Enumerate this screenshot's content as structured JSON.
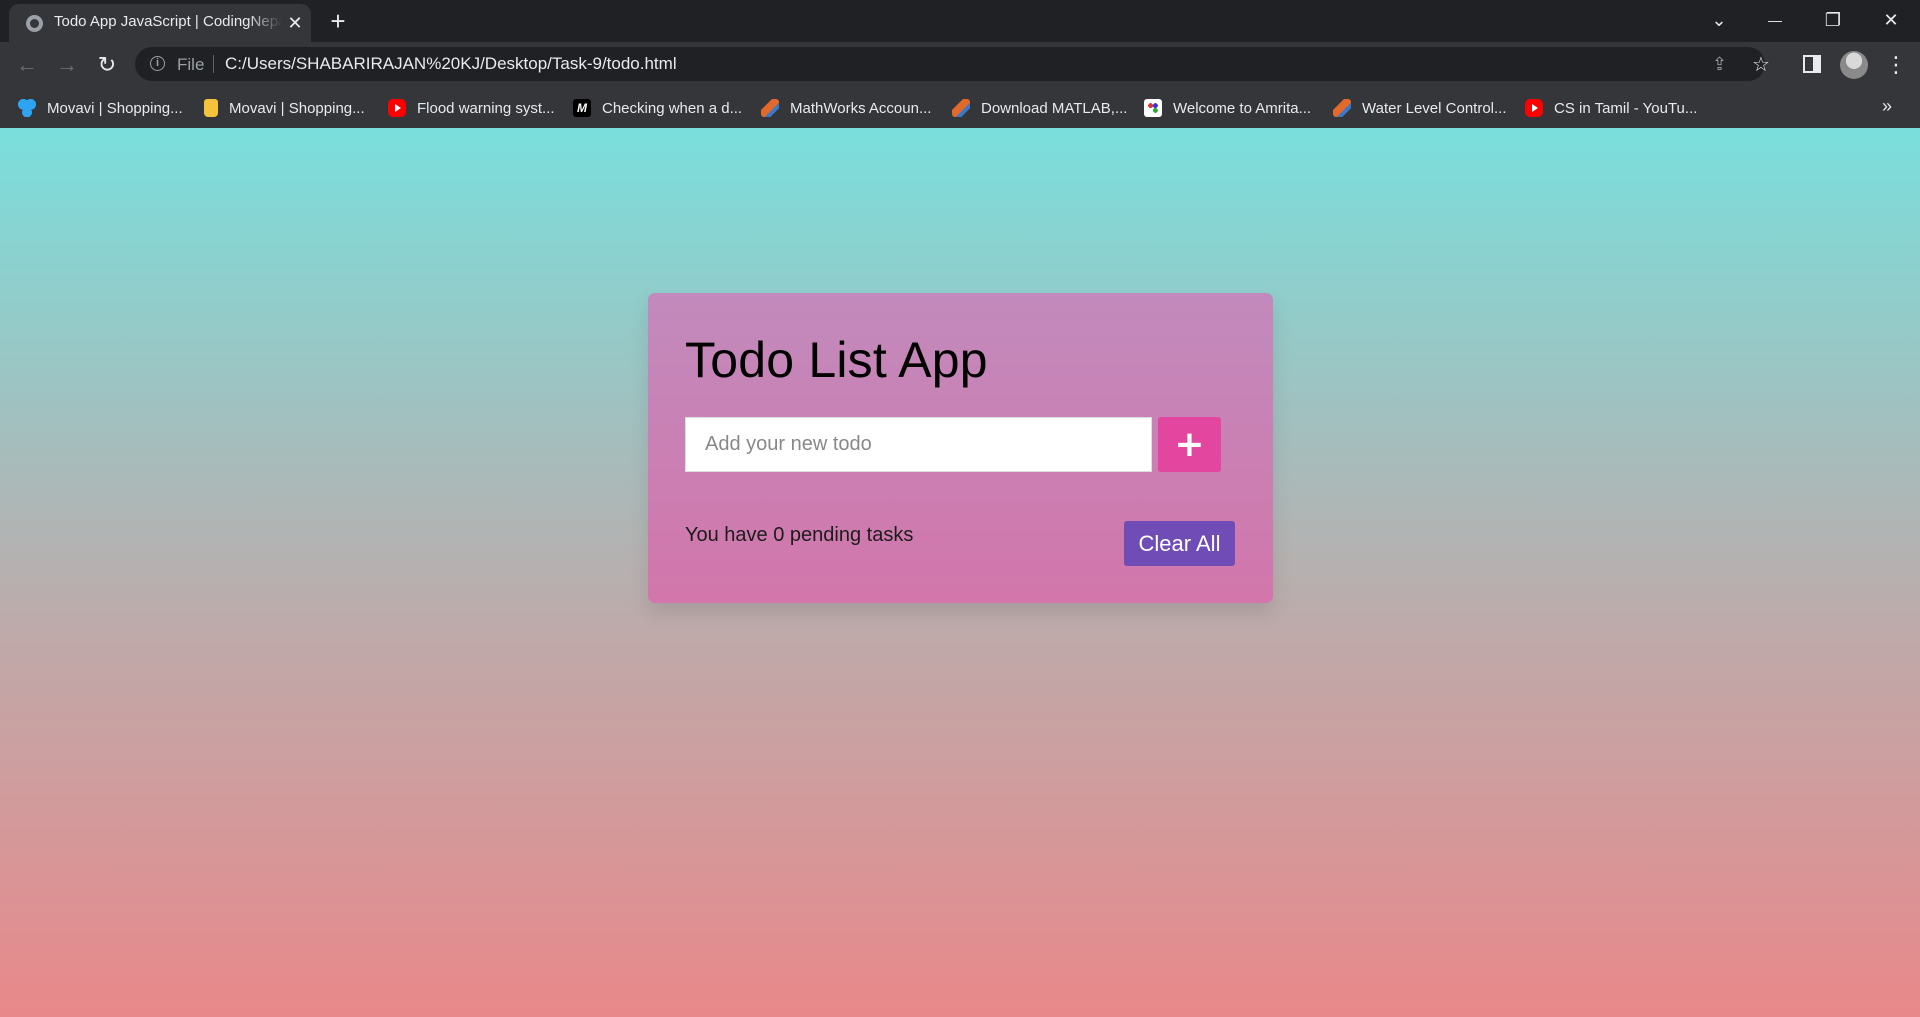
{
  "browser": {
    "tab_title": "Todo App JavaScript | CodingNepal",
    "tab_close_glyph": "✕",
    "new_tab_glyph": "+",
    "window_controls": {
      "tabsearch": "⌄",
      "minimize": "—",
      "restore": "❐",
      "close": "✕"
    },
    "nav": {
      "back": "←",
      "forward": "→",
      "reload": "↻"
    },
    "address": {
      "info_glyph": "i",
      "scheme": "File",
      "url": "C:/Users/SHABARIRAJAN%20KJ/Desktop/Task-9/todo.html",
      "share_glyph": "⇪",
      "star_glyph": "☆"
    },
    "menu_glyph": "⋮",
    "bookmarks": [
      {
        "label": "Movavi | Shopping...",
        "icon": "movavi-icon"
      },
      {
        "label": "Movavi | Shopping...",
        "icon": "lock-icon"
      },
      {
        "label": "Flood warning syst...",
        "icon": "youtube-icon"
      },
      {
        "label": "Checking when a d...",
        "icon": "m-logo-icon"
      },
      {
        "label": "MathWorks Accoun...",
        "icon": "matlab-icon"
      },
      {
        "label": "Download MATLAB,...",
        "icon": "matlab-icon"
      },
      {
        "label": "Welcome to Amrita...",
        "icon": "amrita-icon"
      },
      {
        "label": "Water Level Control...",
        "icon": "matlab-icon"
      },
      {
        "label": "CS in Tamil - YouTu...",
        "icon": "youtube-icon"
      }
    ],
    "bookmarks_more": "»"
  },
  "app": {
    "title": "Todo List App",
    "input_placeholder": "Add your new todo",
    "add_label": "+",
    "pending_text": "You have 0 pending tasks",
    "clear_label": "Clear All"
  },
  "colors": {
    "bg_top": "#79dfdc",
    "bg_bottom": "#e9888a",
    "card": "#c983b6",
    "add_button": "#e2469f",
    "clear_button": "#704db6"
  }
}
